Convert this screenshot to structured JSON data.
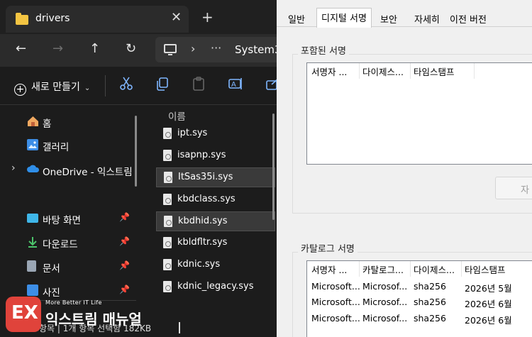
{
  "explorer": {
    "tab": {
      "title": "drivers",
      "close": "✕"
    },
    "new_tab": "+",
    "nav": {
      "back": "←",
      "forward": "→",
      "up": "↑",
      "refresh": "↻"
    },
    "address": {
      "chevron": "›",
      "more": "···",
      "crumb": "System3"
    },
    "toolbar": {
      "new_label": "새로 만들기",
      "new_caret": "⌄"
    },
    "sidebar": {
      "items": [
        {
          "label": "홈",
          "icon": "home-icon"
        },
        {
          "label": "갤러리",
          "icon": "gallery-icon"
        },
        {
          "label": "OneDrive - 익스트림",
          "icon": "onedrive-icon",
          "expand": "›"
        },
        {
          "label": "바탕 화면",
          "icon": "desktop-icon",
          "pin": "📌"
        },
        {
          "label": "다운로드",
          "icon": "download-icon",
          "pin": "📌"
        },
        {
          "label": "문서",
          "icon": "documents-icon",
          "pin": "📌"
        },
        {
          "label": "사진",
          "icon": "pictures-icon",
          "pin": "📌"
        }
      ]
    },
    "files": {
      "column_name": "이름",
      "rows": [
        {
          "name": "ipt.sys",
          "selected": false
        },
        {
          "name": "isapnp.sys",
          "selected": false
        },
        {
          "name": "ItSas35i.sys",
          "selected": true
        },
        {
          "name": "kbdclass.sys",
          "selected": false
        },
        {
          "name": "kbdhid.sys",
          "selected": true
        },
        {
          "name": "kbldfltr.sys",
          "selected": false
        },
        {
          "name": "kdnic.sys",
          "selected": false
        },
        {
          "name": "kdnic_legacy.sys",
          "selected": false
        }
      ]
    },
    "status": {
      "text": "항목  |  1개 항목 선택함 182KB"
    }
  },
  "watermark": {
    "mark": "EX",
    "tagline": "More Better IT Life",
    "name": "익스트림 매뉴얼"
  },
  "dialog": {
    "tabs": [
      {
        "label": "일반",
        "active": false
      },
      {
        "label": "디지털 서명",
        "active": true
      },
      {
        "label": "보안",
        "active": false
      },
      {
        "label": "자세히",
        "active": false
      },
      {
        "label": "이전 버전",
        "active": false
      }
    ],
    "embedded": {
      "group_label": "포함된 서명",
      "columns": [
        "서명자 ...",
        "다이제스...",
        "타임스탬프"
      ],
      "rows": []
    },
    "details_button": "자",
    "catalog": {
      "group_label": "카탈로그 서명",
      "columns": [
        "서명자 ...",
        "카탈로그...",
        "다이제스...",
        "타임스탬프"
      ],
      "rows": [
        [
          "Microsoft...",
          "Microsof...",
          "sha256",
          "2026년 5월"
        ],
        [
          "Microsoft...",
          "Microsof...",
          "sha256",
          "2026년 6월"
        ],
        [
          "Microsoft...",
          "Microsof...",
          "sha256",
          "2026년 6월"
        ]
      ]
    }
  },
  "colors": {
    "explorer_bg": "#1c1c1c",
    "folder_yellow": "#f3c442",
    "toolbar_icon_blue": "#7fb6ff",
    "dialog_bg": "#f0f0f0",
    "logo_red": "#e0433b"
  }
}
